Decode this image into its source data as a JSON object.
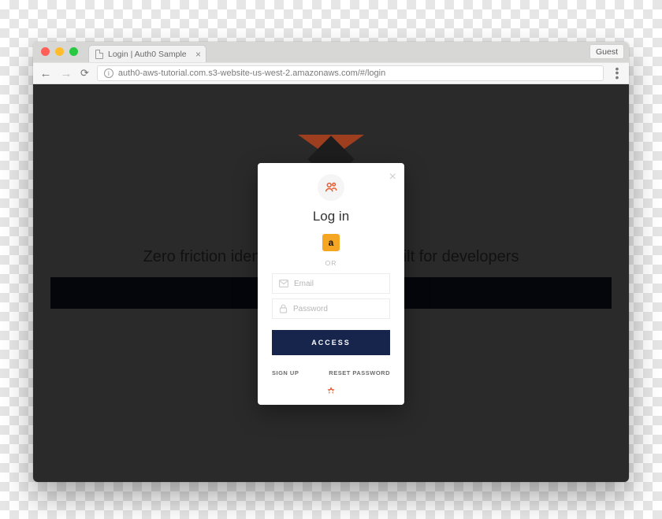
{
  "browser": {
    "tab": {
      "title": "Login | Auth0 Sample"
    },
    "guest_label": "Guest",
    "url": "auth0-aws-tutorial.com.s3-website-us-west-2.amazonaws.com/#/login"
  },
  "page": {
    "tagline": "Zero friction identity infrastructure, built for developers"
  },
  "login": {
    "title": "Log in",
    "amazon_glyph": "a",
    "or_label": "OR",
    "email_placeholder": "Email",
    "password_placeholder": "Password",
    "submit_label": "ACCESS",
    "signup_label": "SIGN UP",
    "reset_label": "RESET PASSWORD"
  },
  "colors": {
    "accent": "#e85c2f",
    "submit_bg": "#17244c",
    "amazon_bg": "#f5a623"
  }
}
